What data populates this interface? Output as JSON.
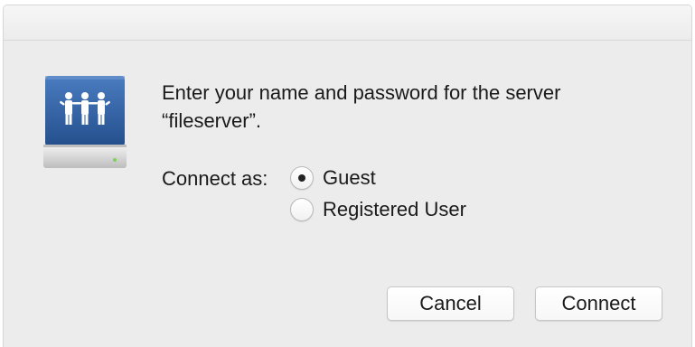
{
  "dialog": {
    "prompt_line1": "Enter your name and password for the server",
    "prompt_line2": "“fileserver”.",
    "icon": "shared-server-icon"
  },
  "connect_as": {
    "label": "Connect as:",
    "options": [
      {
        "label": "Guest",
        "selected": true
      },
      {
        "label": "Registered User",
        "selected": false
      }
    ]
  },
  "buttons": {
    "cancel_label": "Cancel",
    "connect_label": "Connect"
  },
  "colors": {
    "window_bg": "#ececec",
    "icon_blue": "#2f5f9e",
    "icon_drive": "#d9d9d9"
  }
}
